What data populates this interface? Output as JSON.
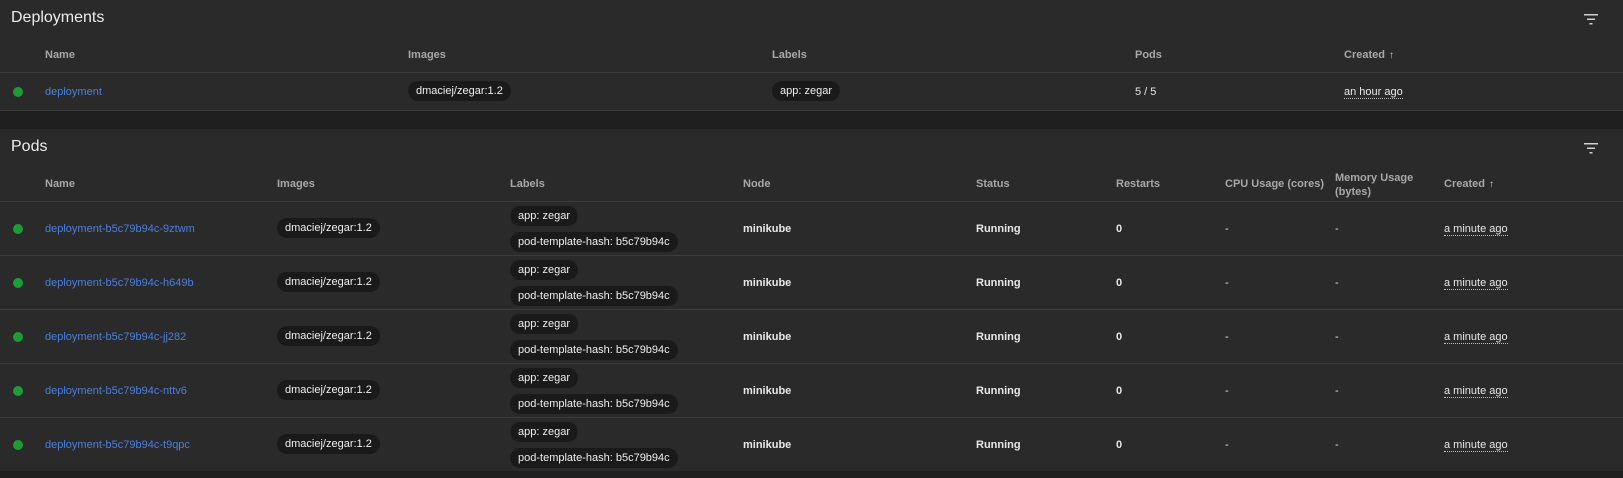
{
  "deployments": {
    "title": "Deployments",
    "columns": {
      "name": "Name",
      "images": "Images",
      "labels": "Labels",
      "pods": "Pods",
      "created": "Created",
      "sort_icon": "↑"
    },
    "rows": [
      {
        "name": "deployment",
        "image": "dmaciej/zegar:1.2",
        "label": "app: zegar",
        "pods": "5 / 5",
        "created": "an hour ago",
        "status_color": "#1e9b36"
      }
    ]
  },
  "pods": {
    "title": "Pods",
    "columns": {
      "name": "Name",
      "images": "Images",
      "labels": "Labels",
      "node": "Node",
      "status": "Status",
      "restarts": "Restarts",
      "cpu": "CPU Usage (cores)",
      "memory": "Memory Usage (bytes)",
      "created": "Created",
      "sort_icon": "↑"
    },
    "rows": [
      {
        "name": "deployment-b5c79b94c-9ztwm",
        "image": "dmaciej/zegar:1.2",
        "label1": "app: zegar",
        "label2": "pod-template-hash: b5c79b94c",
        "node": "minikube",
        "status": "Running",
        "restarts": "0",
        "cpu": "-",
        "memory": "-",
        "created": "a minute ago"
      },
      {
        "name": "deployment-b5c79b94c-h649b",
        "image": "dmaciej/zegar:1.2",
        "label1": "app: zegar",
        "label2": "pod-template-hash: b5c79b94c",
        "node": "minikube",
        "status": "Running",
        "restarts": "0",
        "cpu": "-",
        "memory": "-",
        "created": "a minute ago"
      },
      {
        "name": "deployment-b5c79b94c-jj282",
        "image": "dmaciej/zegar:1.2",
        "label1": "app: zegar",
        "label2": "pod-template-hash: b5c79b94c",
        "node": "minikube",
        "status": "Running",
        "restarts": "0",
        "cpu": "-",
        "memory": "-",
        "created": "a minute ago"
      },
      {
        "name": "deployment-b5c79b94c-nttv6",
        "image": "dmaciej/zegar:1.2",
        "label1": "app: zegar",
        "label2": "pod-template-hash: b5c79b94c",
        "node": "minikube",
        "status": "Running",
        "restarts": "0",
        "cpu": "-",
        "memory": "-",
        "created": "a minute ago"
      },
      {
        "name": "deployment-b5c79b94c-t9qpc",
        "image": "dmaciej/zegar:1.2",
        "label1": "app: zegar",
        "label2": "pod-template-hash: b5c79b94c",
        "node": "minikube",
        "status": "Running",
        "restarts": "0",
        "cpu": "-",
        "memory": "-",
        "created": "a minute ago"
      }
    ]
  },
  "icons": {
    "filter": "filter-icon",
    "status": "status-dot-icon",
    "sort": "arrow-up-icon"
  },
  "colors": {
    "link": "#4a7fe0",
    "status_ok": "#1e9b36",
    "card": "#2a2a2a",
    "background": "#1f1f1f"
  }
}
